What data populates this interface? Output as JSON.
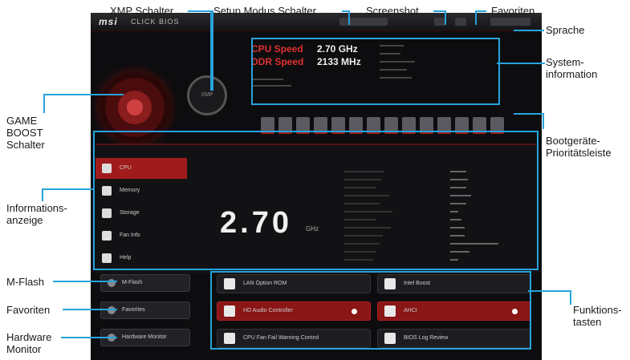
{
  "callouts": {
    "xmp": "XMP Schalter",
    "setup": "Setup Modus Schalter",
    "screenshot": "Screenshot",
    "favorites_top": "Favoriten",
    "language": "Sprache",
    "sysinfo": "System-\ninformation",
    "gameboost": "GAME\nBOOST\nSchalter",
    "bootbar": "Bootgeräte-\nPrioritätsleiste",
    "infodisplay": "Informations-\nanzeige",
    "mflash": "M-Flash",
    "favorites_left": "Favoriten",
    "hwmonitor": "Hardware\nMonitor",
    "functionkeys": "Funktions-\ntasten"
  },
  "bios": {
    "logo": "msi",
    "logo_sub": "CLICK BIOS",
    "cpu_speed_label": "CPU Speed",
    "cpu_speed_value": "2.70 GHz",
    "ddr_speed_label": "DDR Speed",
    "ddr_speed_value": "2133 MHz",
    "tabs": [
      "CPU",
      "Memory",
      "Storage",
      "Fan Info",
      "Help"
    ],
    "frequency": "2.70",
    "frequency_unit": "GHz",
    "side_buttons": [
      "M-Flash",
      "Favorites",
      "Hardware Monitor"
    ],
    "function_keys": [
      {
        "label": "LAN Option ROM",
        "red": false
      },
      {
        "label": "Intel Boost",
        "red": false
      },
      {
        "label": "HD Audio Controller",
        "red": true
      },
      {
        "label": "AHCI",
        "red": true
      },
      {
        "label": "CPU Fan Fail Warning Control",
        "red": false
      },
      {
        "label": "BIOS Log Review",
        "red": false
      }
    ]
  },
  "colors": {
    "accent_line": "#27a3dc",
    "bios_red": "#a01c1c"
  }
}
